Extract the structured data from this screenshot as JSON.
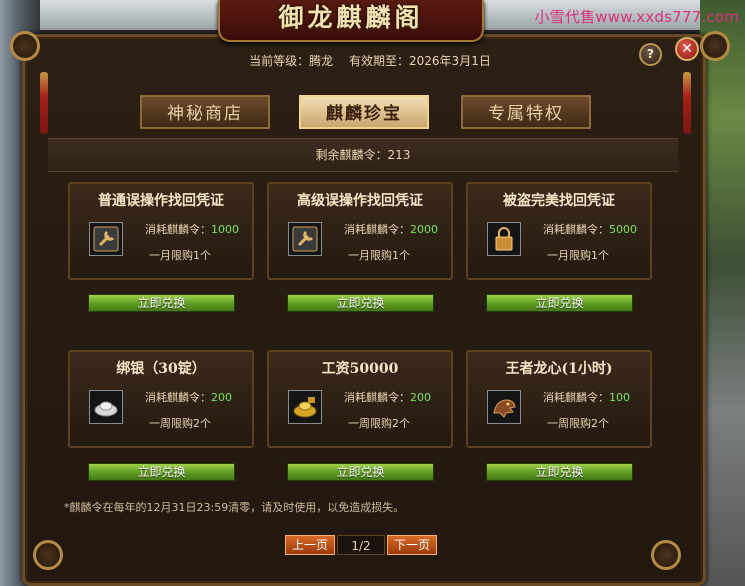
{
  "watermark": "小雪代售www.xxds777.com",
  "window": {
    "title": "御龙麒麟阁",
    "help_label": "?",
    "close_label": "✕"
  },
  "info": {
    "level_label": "当前等级：腾龙",
    "expire_label": "有效期至：2026年3月1日"
  },
  "tabs": [
    {
      "label": "神秘商店",
      "active": false
    },
    {
      "label": "麒麟珍宝",
      "active": true
    },
    {
      "label": "专属特权",
      "active": false
    }
  ],
  "remaining": "剩余麒麟令：213",
  "cost_prefix": "消耗麒麟令：",
  "items": [
    {
      "title": "普通误操作找回凭证",
      "cost": "1000",
      "limit": "一月限购1个",
      "button": "立即兑换",
      "icon": "wrench-icon"
    },
    {
      "title": "高级误操作找回凭证",
      "cost": "2000",
      "limit": "一月限购1个",
      "button": "立即兑换",
      "icon": "wrench-icon"
    },
    {
      "title": "被盗完美找回凭证",
      "cost": "5000",
      "limit": "一月限购1个",
      "button": "立即兑换",
      "icon": "lock-icon"
    },
    {
      "title": "绑银（30锭）",
      "cost": "200",
      "limit": "一周限购2个",
      "button": "立即兑换",
      "icon": "silver-ingot-icon"
    },
    {
      "title": "工资50000",
      "cost": "200",
      "limit": "一周限购2个",
      "button": "立即兑换",
      "icon": "gold-ingot-icon"
    },
    {
      "title": "王者龙心(1小时)",
      "cost": "100",
      "limit": "一周限购2个",
      "button": "立即兑换",
      "icon": "dragon-head-icon"
    }
  ],
  "note": "*麒麟令在每年的12月31日23:59清零，请及时使用，以免造成损失。",
  "pager": {
    "prev": "上一页",
    "page": "1/2",
    "next": "下一页"
  }
}
